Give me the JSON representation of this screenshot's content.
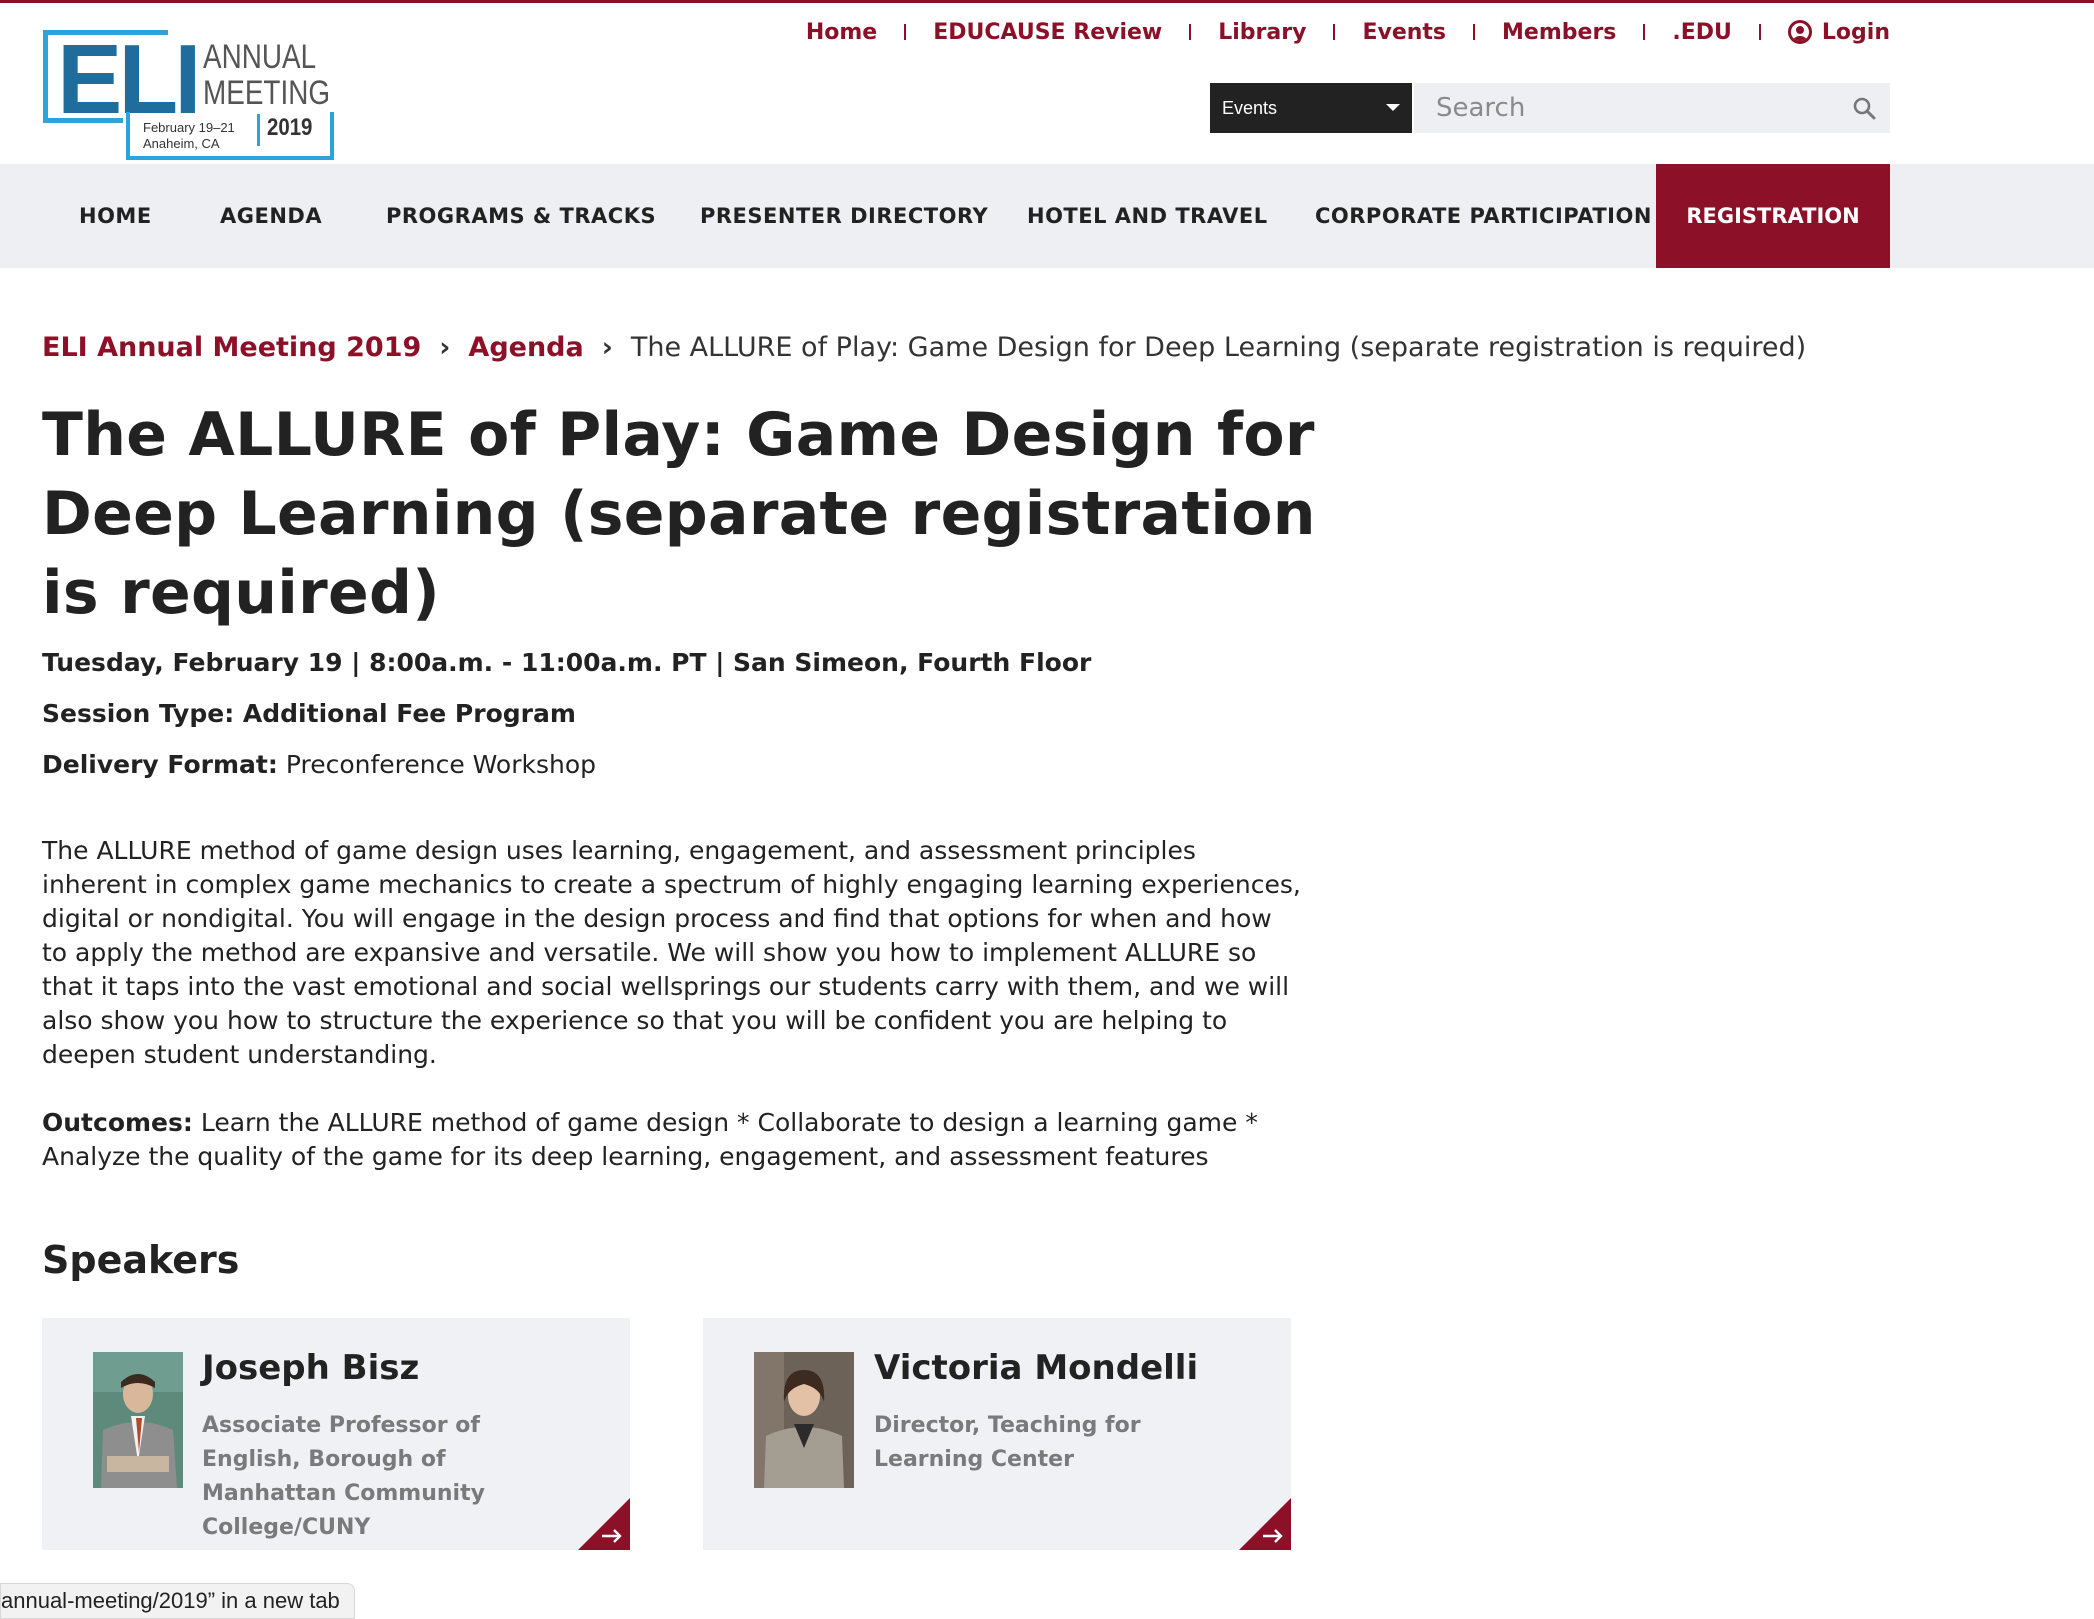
{
  "brand": {
    "logo_main": "ELI",
    "logo_line1": "ANNUAL",
    "logo_line2": "MEETING",
    "logo_dates": "February 19–21",
    "logo_location": "Anaheim, CA",
    "logo_year": "2019",
    "accent_color": "#8b1028",
    "logo_blue": "#2ba4d8"
  },
  "utility_nav": [
    {
      "label": "Home"
    },
    {
      "label": "EDUCAUSE Review"
    },
    {
      "label": "Library"
    },
    {
      "label": "Events"
    },
    {
      "label": "Members"
    },
    {
      "label": ".EDU"
    }
  ],
  "login": {
    "label": "Login",
    "icon": "user-circle-icon"
  },
  "search": {
    "scope_selected": "Events",
    "placeholder": "Search",
    "icon": "search-icon"
  },
  "main_nav": [
    {
      "label": "HOME"
    },
    {
      "label": "AGENDA"
    },
    {
      "label": "PROGRAMS & TRACKS"
    },
    {
      "label": "PRESENTER DIRECTORY"
    },
    {
      "label": "HOTEL AND TRAVEL"
    },
    {
      "label": "CORPORATE PARTICIPATION"
    }
  ],
  "registration_label": "REGISTRATION",
  "breadcrumb": {
    "items": [
      "ELI Annual Meeting 2019",
      "Agenda"
    ],
    "current": "The ALLURE of Play: Game Design for Deep Learning (separate registration is required)"
  },
  "session": {
    "title": "The ALLURE of Play: Game Design for Deep Learning (separate registration is required)",
    "datetime_location": "Tuesday, February 19 | 8:00a.m. - 11:00a.m. PT | San Simeon, Fourth Floor",
    "session_type": "Session Type: Additional Fee Program",
    "delivery_label": "Delivery Format:",
    "delivery_value": "Preconference Workshop",
    "description": "The ALLURE method of game design uses learning, engagement, and assessment principles inherent in complex game mechanics to create a spectrum of highly engaging learning experiences, digital or nondigital. You will engage in the design process and find that options for when and how to apply the method are expansive and versatile. We will show you how to implement ALLURE so that it taps into the vast emotional and social wellsprings our students carry with them, and we will also show you how to structure the experience so that you will be confident you are helping to deepen student understanding.",
    "outcomes_label": "Outcomes:",
    "outcomes_text": "Learn the ALLURE method of game design * Collaborate to design a learning game * Analyze the quality of the game for its deep learning, engagement, and assessment features"
  },
  "speakers": {
    "heading": "Speakers",
    "items": [
      {
        "name": "Joseph Bisz",
        "role": "Associate Professor of English, Borough of Manhattan Community College/CUNY"
      },
      {
        "name": "Victoria Mondelli",
        "role": "Director, Teaching for Learning Center"
      }
    ]
  },
  "status_bar": "annual-meeting/2019” in a new tab"
}
